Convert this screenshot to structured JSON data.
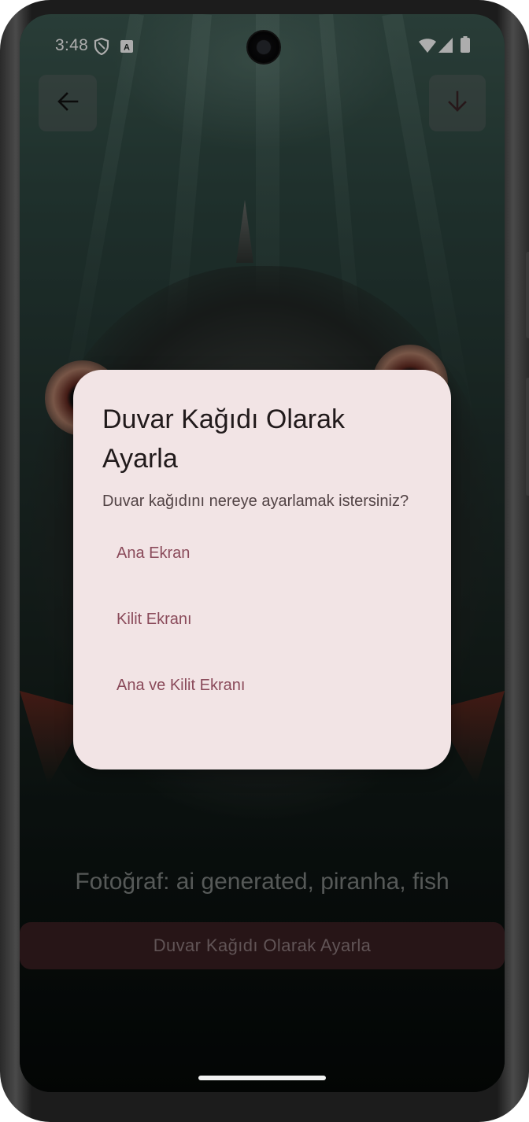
{
  "status_bar": {
    "time": "3:48",
    "left_icons": [
      "shield-icon",
      "keyboard-a-icon"
    ],
    "right_icons": [
      "wifi-icon",
      "signal-icon",
      "battery-icon"
    ]
  },
  "toolbar": {
    "back_icon": "arrow-left-icon",
    "download_icon": "arrow-down-icon"
  },
  "photo": {
    "caption": "Fotoğraf: ai generated, piranha, fish"
  },
  "bottom_button": {
    "label": "Duvar Kağıdı Olarak Ayarla"
  },
  "dialog": {
    "title": "Duvar Kağıdı Olarak Ayarla",
    "message": "Duvar kağıdını nereye ayarlamak istersiniz?",
    "options": [
      {
        "label": "Ana Ekran"
      },
      {
        "label": "Kilit Ekranı"
      },
      {
        "label": "Ana ve Kilit Ekranı"
      }
    ]
  },
  "colors": {
    "dialog_background": "#f2e4e5",
    "dialog_title": "#211a1b",
    "option_accent": "#8a4a5a",
    "bottom_button": "#3a1f22"
  }
}
